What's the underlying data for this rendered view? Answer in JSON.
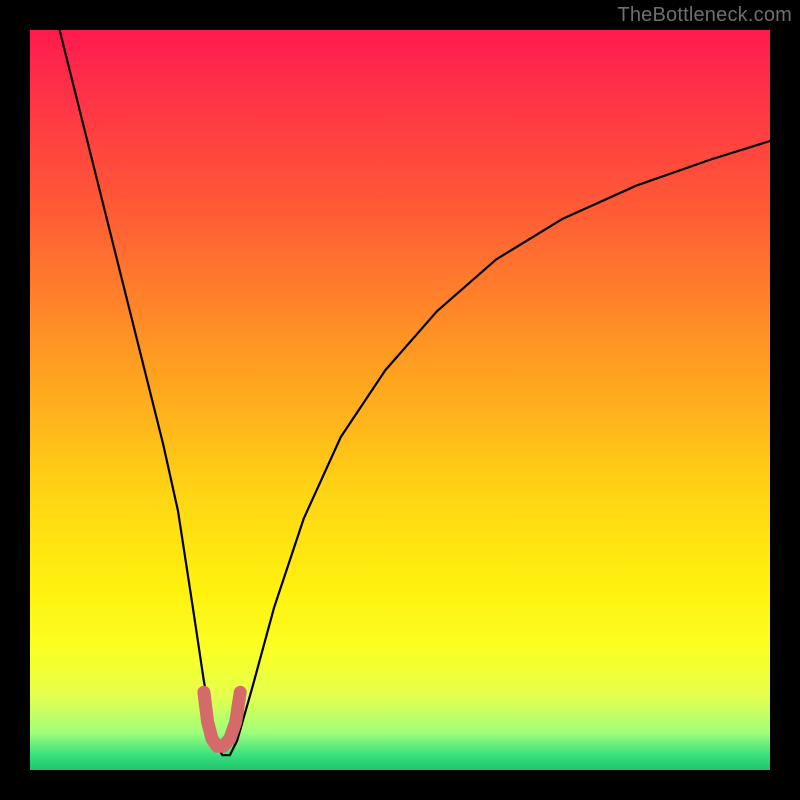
{
  "watermark": {
    "text": "TheBottleneck.com"
  },
  "chart_data": {
    "type": "line",
    "title": "",
    "xlabel": "",
    "ylabel": "",
    "xlim": [
      0,
      100
    ],
    "ylim": [
      0,
      100
    ],
    "series": [
      {
        "name": "black-curve",
        "x": [
          4,
          6,
          8,
          10,
          12,
          14,
          16,
          18,
          20,
          22,
          23.5,
          25,
          26,
          27,
          28,
          30,
          33,
          37,
          42,
          48,
          55,
          63,
          72,
          82,
          92,
          100
        ],
        "y": [
          100,
          92,
          84,
          76,
          68,
          60,
          52,
          44,
          35,
          22,
          12,
          4,
          2,
          2,
          4,
          11,
          22,
          34,
          45,
          54,
          62,
          69,
          74.5,
          79,
          82.5,
          85
        ]
      },
      {
        "name": "red-marker",
        "x": [
          23.5,
          24,
          24.6,
          25.3,
          26.1,
          27,
          27.8,
          28.4
        ],
        "y": [
          10.5,
          6.5,
          4.2,
          3.2,
          3.2,
          4.2,
          6.5,
          10.5
        ]
      }
    ],
    "background_gradient": {
      "top": "#ff1a4d",
      "mid": "#ffe611",
      "bottom": "#1fc56b"
    }
  }
}
